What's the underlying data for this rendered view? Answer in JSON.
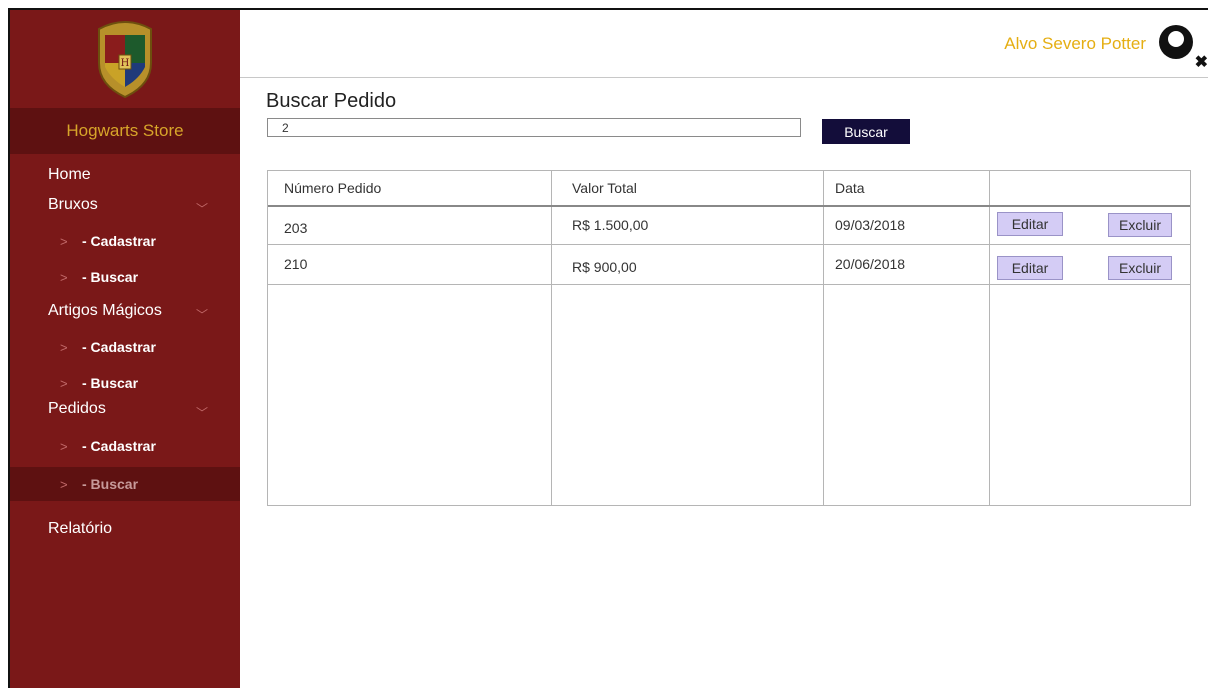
{
  "sidebar": {
    "brand": "Hogwarts Store",
    "menu": [
      {
        "label": "Home"
      },
      {
        "label": "Bruxos",
        "sub": [
          "- Cadastrar",
          "- Buscar"
        ]
      },
      {
        "label": "Artigos Mágicos",
        "sub": [
          "- Cadastrar",
          "- Buscar"
        ]
      },
      {
        "label": "Pedidos",
        "sub": [
          "- Cadastrar",
          "- Buscar"
        ]
      },
      {
        "label": "Relatório"
      }
    ],
    "active_item": "Pedidos / - Buscar"
  },
  "header": {
    "user_name": "Alvo Severo Potter"
  },
  "main": {
    "title": "Buscar Pedido",
    "search_value": "2",
    "search_button": "Buscar",
    "table": {
      "columns": [
        "Número Pedido",
        "Valor Total",
        "Data",
        ""
      ],
      "rows": [
        {
          "numero": "203",
          "valor": "R$ 1.500,00",
          "data": "09/03/2018"
        },
        {
          "numero": "210",
          "valor": "R$ 900,00",
          "data": "20/06/2018"
        }
      ],
      "edit_label": "Editar",
      "delete_label": "Excluir"
    }
  },
  "colors": {
    "sidebar": "#7a1818",
    "sidebar_dark": "#5e1111",
    "brand_gold": "#d7a52a",
    "user_name": "#e5ae12",
    "search_button": "#130d3a",
    "row_button": "#d4ccf5"
  },
  "icons": [
    "hogwarts-crest-logo",
    "chevron-down-icon",
    "chevron-right-icon",
    "user-avatar-icon",
    "close-icon"
  ]
}
